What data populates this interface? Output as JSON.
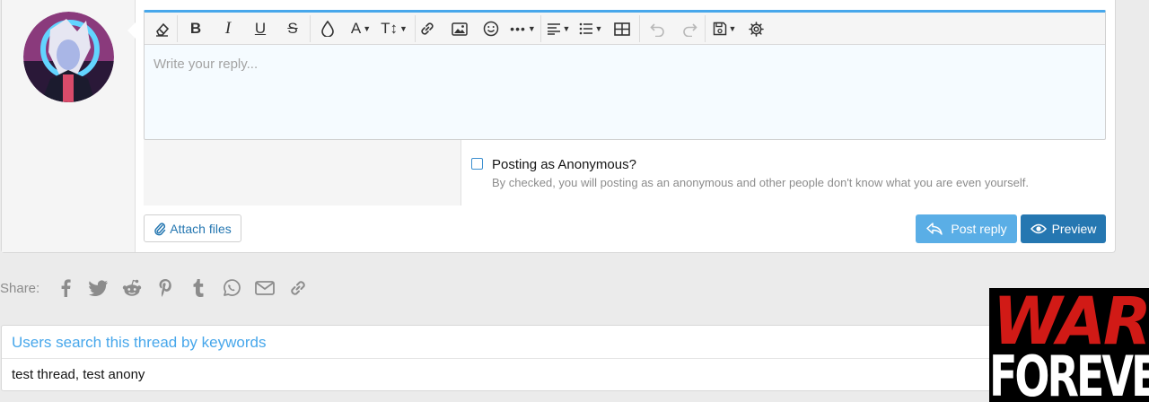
{
  "editor": {
    "placeholder": "Write your reply...",
    "toolbar": [
      {
        "name": "remove-formatting-icon"
      },
      {
        "name": "bold-icon",
        "glyph": "B"
      },
      {
        "name": "italic-icon",
        "glyph": "I"
      },
      {
        "name": "underline-icon",
        "glyph": "U"
      },
      {
        "name": "strikethrough-icon",
        "glyph": "S"
      },
      {
        "name": "text-color-icon"
      },
      {
        "name": "font-family-icon",
        "glyph": "A"
      },
      {
        "name": "font-size-icon",
        "glyph": "T↕"
      },
      {
        "name": "insert-link-icon"
      },
      {
        "name": "insert-image-icon"
      },
      {
        "name": "smilies-icon"
      },
      {
        "name": "more-options-icon"
      },
      {
        "name": "align-icon"
      },
      {
        "name": "list-icon"
      },
      {
        "name": "insert-table-icon"
      },
      {
        "name": "undo-icon",
        "state": "disabled"
      },
      {
        "name": "redo-icon",
        "state": "disabled"
      },
      {
        "name": "drafts-icon"
      },
      {
        "name": "settings-gear-icon"
      }
    ],
    "accent_color": "#47a7eb"
  },
  "anonymous": {
    "label": "Posting as Anonymous?",
    "hint": "By checked, you will posting as an anonymous and other people don't know what you are even yourself.",
    "checked": false
  },
  "actions": {
    "attach_label": "Attach files",
    "post_reply_label": "Post reply",
    "preview_label": "Preview"
  },
  "share": {
    "label": "Share:",
    "icons": [
      "facebook-icon",
      "twitter-icon",
      "reddit-icon",
      "pinterest-icon",
      "tumblr-icon",
      "whatsapp-icon",
      "email-icon",
      "link-icon"
    ]
  },
  "keywords": {
    "title": "Users search this thread by keywords",
    "text": "test thread, test anony"
  },
  "logo": {
    "line1": "WAR",
    "line2": "FOREVER"
  }
}
